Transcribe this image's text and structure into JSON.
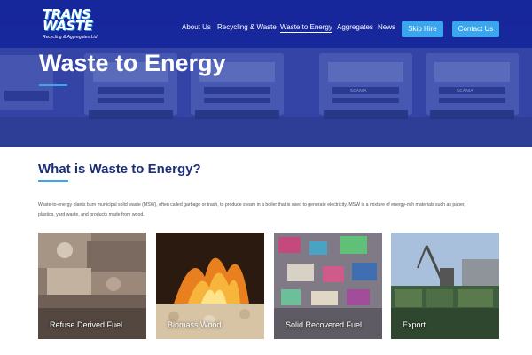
{
  "header": {
    "logo": {
      "line1": "TRANS",
      "line2": "WASTE",
      "tagline": "Recycling & Aggregates Ltd"
    },
    "nav": [
      {
        "label": "About Us"
      },
      {
        "label": "Recycling & Waste"
      },
      {
        "label": "Waste to Energy",
        "active": true
      },
      {
        "label": "Aggregates"
      },
      {
        "label": "News"
      }
    ],
    "buttons": {
      "skip_hire": "Skip Hire",
      "contact_us": "Contact Us"
    },
    "colors": {
      "navbar": "#16269b",
      "button": "#3aa6f0",
      "title": "#1c2f7a"
    }
  },
  "hero": {
    "title": "Waste to Energy",
    "truck_brand": "SCANIA"
  },
  "main": {
    "heading": "What is Waste to Energy?",
    "intro": "Waste-to-energy plants burn municipal solid waste (MSW), often called garbage or trash, to produce steam in a boiler that is used to generate electricity. MSW is a mixture of energy-rich materials such as paper, plastics, yard waste, and products made from wood.",
    "cards": [
      {
        "label": "Refuse Derived Fuel"
      },
      {
        "label": "Biomass Wood"
      },
      {
        "label": "Solid Recovered Fuel"
      },
      {
        "label": "Export"
      }
    ]
  }
}
